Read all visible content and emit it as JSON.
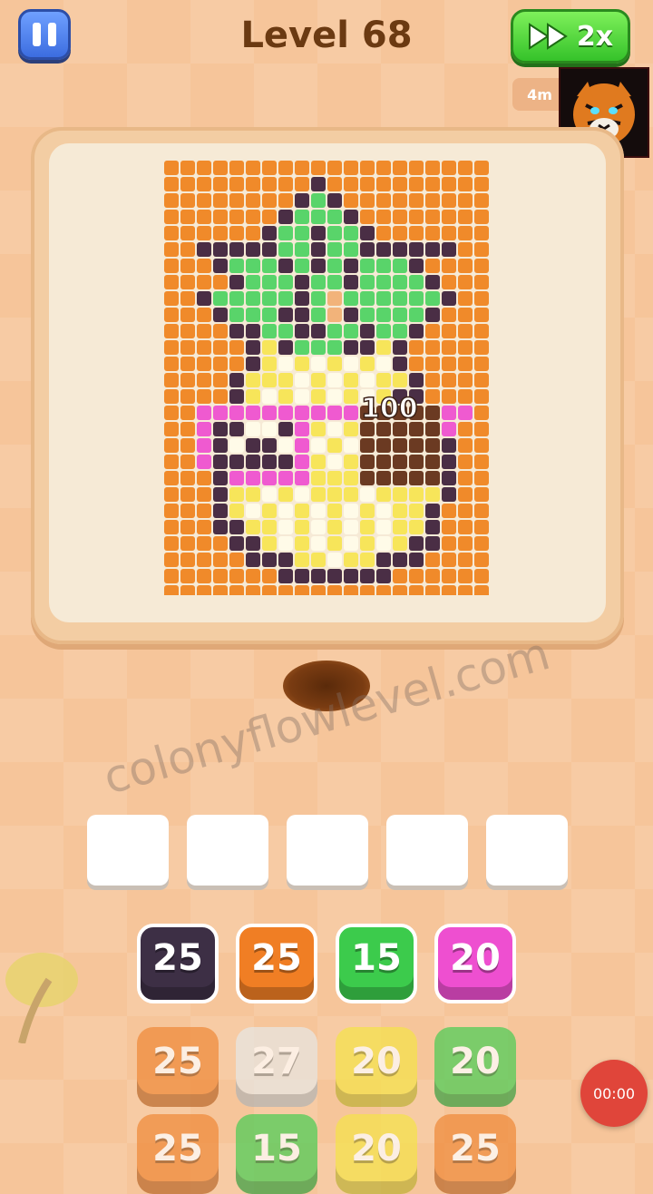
{
  "header": {
    "level_title": "Level 68",
    "speed_label": "2x",
    "moves_text": "4m"
  },
  "board": {
    "cols": 20,
    "rows": 27,
    "colors": {
      "O": "#f08a2a",
      "D": "#4a2e45",
      "G": "#59d46a",
      "Y": "#f7e55a",
      "W": "#fffbe8",
      "P": "#ef5ad0",
      "C": "#6b3a22",
      "L": "#f2b37a"
    },
    "pixels": [
      "OOOOOOOOOOOOOOOOOOOO",
      "OOOOOOOOODOOOOOOOOOO",
      "OOOOOOOODGDOOOOOOOOO",
      "OOOOOOODGGGDOOOOOOOO",
      "OOOOOODGGDGGDOOOOOOO",
      "OODDDDDGGDGGDDDDDDOO",
      "OOODGGGDGDGDGGGDOOOO",
      "OOOODGGGDGGDGGGGDOOO",
      "OODGGGGGDGLGGGGGGDOO",
      "OOODGGGDDGLDGGGGDOOO",
      "OOOODDGGDDGGDGGDOOOO",
      "OOOOODYDGGGDDYDOOOOO",
      "OOOOODYWYWYWYWDOOOOO",
      "OOOODYYYWYWYWYYDOOOO",
      "OOOODYWYWYWYWYDDOOOO",
      "OOPPPPPPPPPPCCCCCPPO",
      "OOPDDWWDPYWYCCCCCPOO",
      "OOPDWDDWPWYWCCCCCDOO",
      "OOPDDDDDPYWYCCCCCDOO",
      "OOODPPPPPYYYCCCCCDOO",
      "OOODYYWYWYYYWYYYYDOO",
      "OOODYWYWYWYWYWYYDOOO",
      "OOODDYYWYWYWYWYYDOOO",
      "OOOODDYWYWYWYWYDDOOO",
      "OOOOODDDYYWYYDDDOOOO",
      "OOOOOOODDDDDDDOOOOOO",
      "OOOOOOOOOOOOOOOOOOOO"
    ],
    "popup_value": "100"
  },
  "watermark": "colonyflowlevel.com",
  "slots": [
    "",
    "",
    "",
    "",
    ""
  ],
  "block_rows": [
    [
      {
        "value": "25",
        "color": "#3d2f45",
        "active": true
      },
      {
        "value": "25",
        "color": "#f07e24",
        "active": true
      },
      {
        "value": "15",
        "color": "#3ccb4c",
        "active": true
      },
      {
        "value": "20",
        "color": "#ee4fd0",
        "active": true
      }
    ],
    [
      {
        "value": "25",
        "color": "#f08a3a",
        "active": false
      },
      {
        "value": "27",
        "color": "#e7e7e4",
        "active": false
      },
      {
        "value": "20",
        "color": "#f5e34a",
        "active": false
      },
      {
        "value": "20",
        "color": "#4ccd55",
        "active": false
      }
    ],
    [
      {
        "value": "25",
        "color": "#f08a3a",
        "active": false
      },
      {
        "value": "15",
        "color": "#4ccd55",
        "active": false
      },
      {
        "value": "20",
        "color": "#f5e34a",
        "active": false
      },
      {
        "value": "25",
        "color": "#f08a3a",
        "active": false
      }
    ]
  ],
  "record_timer": "00:00"
}
